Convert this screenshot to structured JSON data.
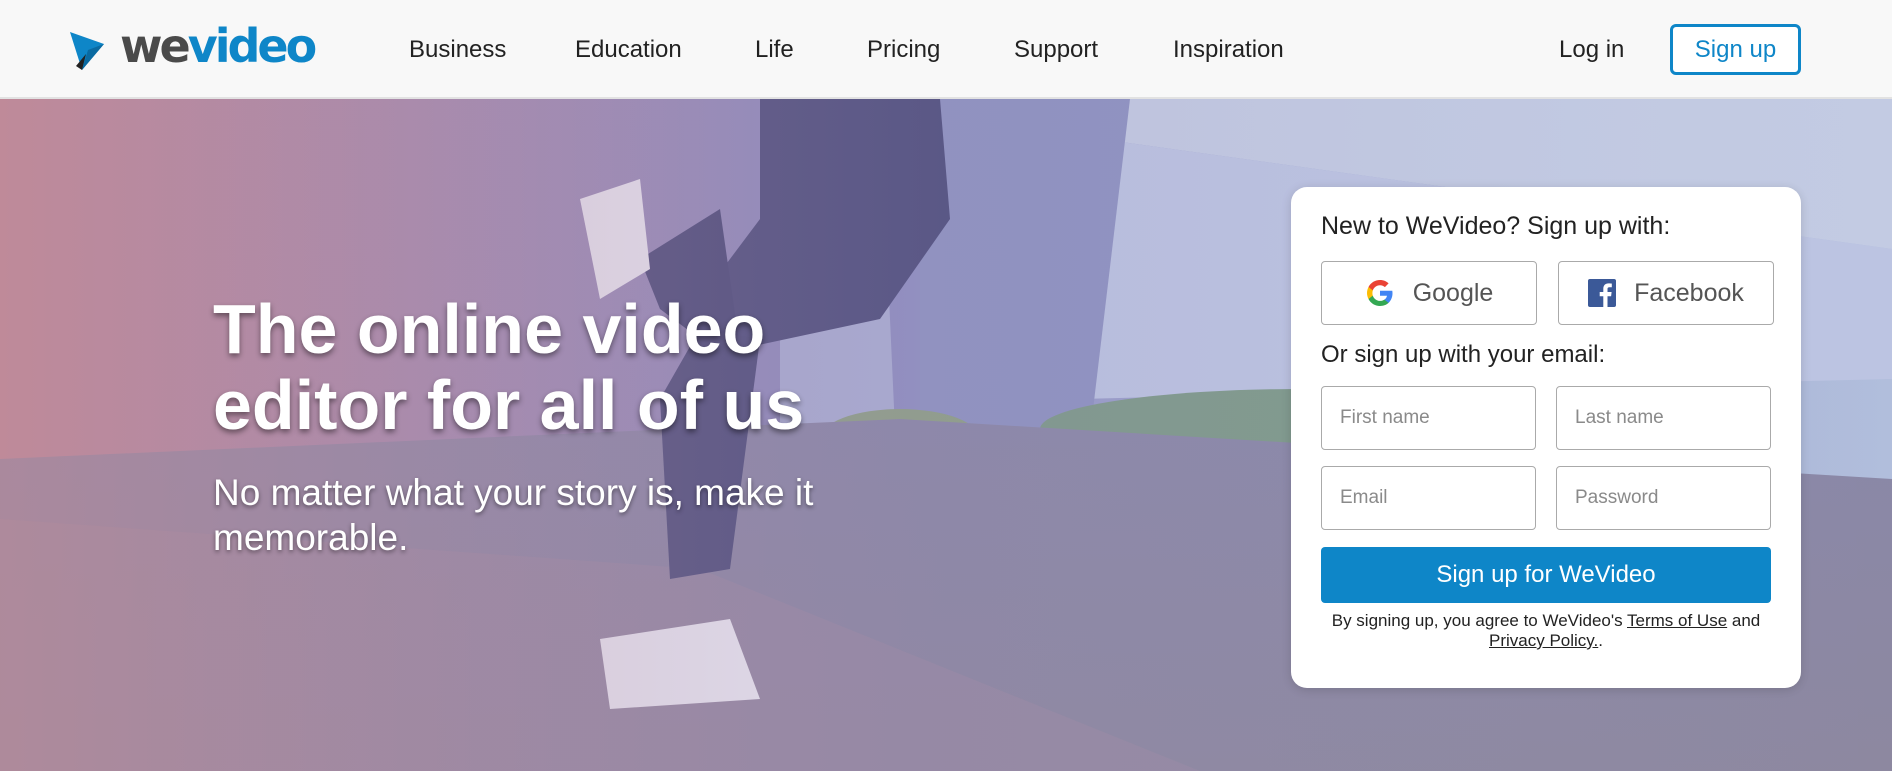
{
  "header": {
    "logo": {
      "part1": "we",
      "part2": "video",
      "icon": "wevideo-play-icon"
    },
    "nav": [
      "Business",
      "Education",
      "Life",
      "Pricing",
      "Support",
      "Inspiration"
    ],
    "login": "Log in",
    "signup": "Sign up"
  },
  "hero": {
    "title": "The online video editor for all of us",
    "subtitle": "No matter what your story is, make it memorable."
  },
  "signup_card": {
    "heading": "New to WeVideo? Sign up with:",
    "google": {
      "label": "Google",
      "icon": "google-icon"
    },
    "facebook": {
      "label": "Facebook",
      "icon": "facebook-icon"
    },
    "email_heading": "Or sign up with your email:",
    "fields": {
      "first_name": {
        "placeholder": "First name",
        "value": ""
      },
      "last_name": {
        "placeholder": "Last name",
        "value": ""
      },
      "email": {
        "placeholder": "Email",
        "value": ""
      },
      "password": {
        "placeholder": "Password",
        "value": ""
      }
    },
    "submit": "Sign up for WeVideo",
    "terms": {
      "prefix": "By signing up, you agree to WeVideo's ",
      "terms_link": "Terms of Use",
      "and": " and ",
      "privacy_link": "Privacy Policy.",
      "suffix": "."
    }
  },
  "colors": {
    "brand_blue": "#0e86c8",
    "logo_grey": "#4a4a4a",
    "facebook_blue": "#3b5998"
  }
}
